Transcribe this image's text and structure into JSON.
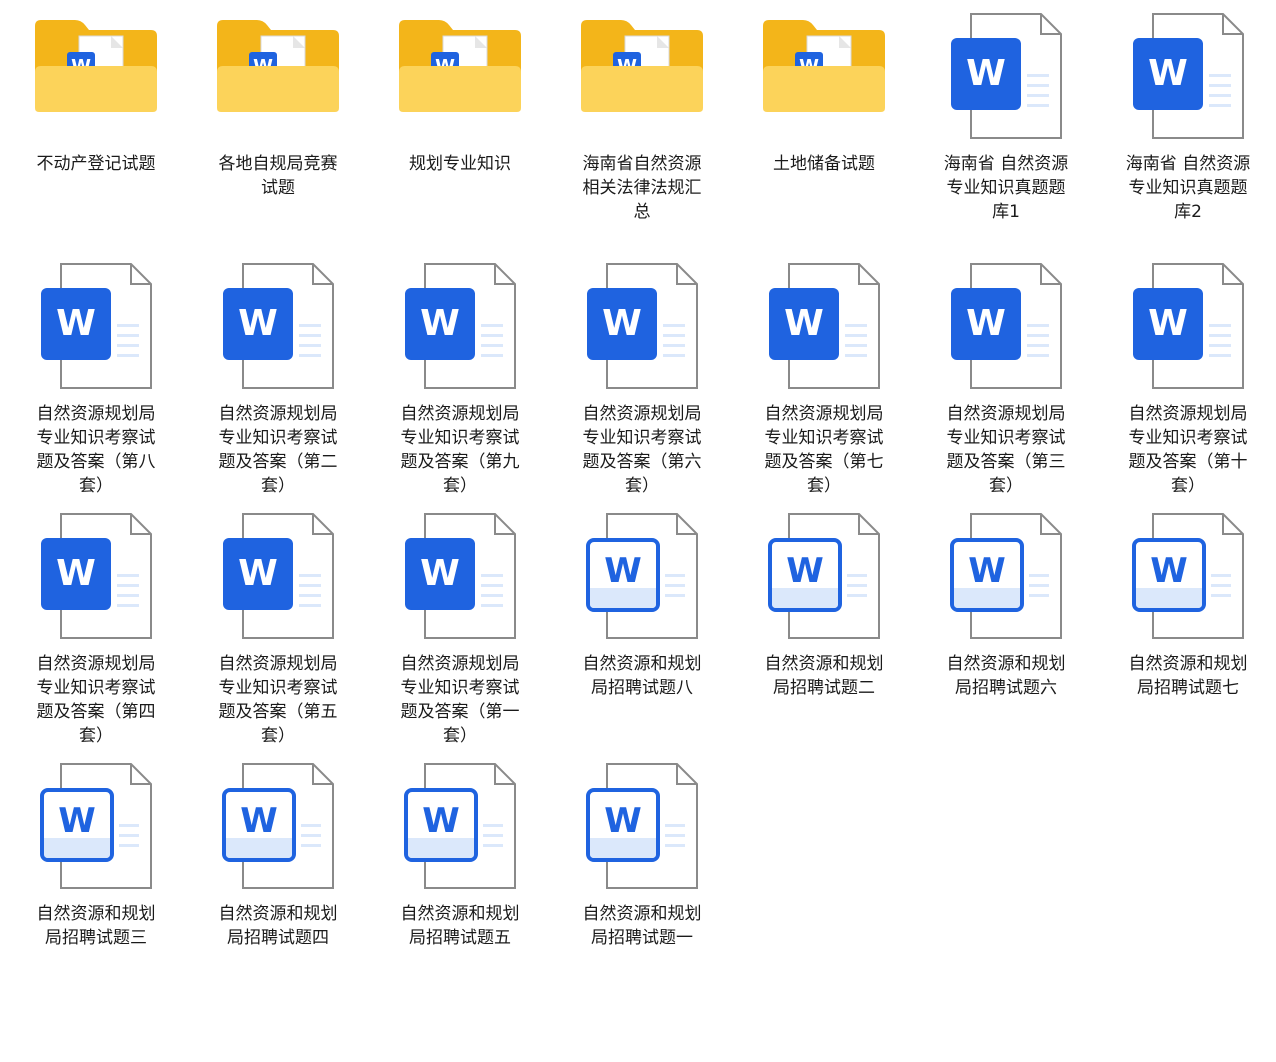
{
  "files": [
    {
      "type": "folder",
      "name": "不动产登记试题"
    },
    {
      "type": "folder",
      "name": "各地自规局竞赛试题"
    },
    {
      "type": "folder",
      "name": "规划专业知识"
    },
    {
      "type": "folder",
      "name": "海南省自然资源相关法律法规汇总"
    },
    {
      "type": "folder",
      "name": "土地储备试题"
    },
    {
      "type": "docx",
      "name": "海南省  自然资源专业知识真题题库1"
    },
    {
      "type": "docx",
      "name": "海南省 自然资源专业知识真题题库2"
    },
    {
      "type": "docx",
      "name": "自然资源规划局专业知识考察试题及答案（第八套）"
    },
    {
      "type": "docx",
      "name": "自然资源规划局专业知识考察试题及答案（第二套）"
    },
    {
      "type": "docx",
      "name": "自然资源规划局专业知识考察试题及答案（第九套）"
    },
    {
      "type": "docx",
      "name": "自然资源规划局专业知识考察试题及答案（第六套）"
    },
    {
      "type": "docx",
      "name": "自然资源规划局专业知识考察试题及答案（第七套）"
    },
    {
      "type": "docx",
      "name": "自然资源规划局专业知识考察试题及答案（第三套）"
    },
    {
      "type": "docx",
      "name": "自然资源规划局专业知识考察试题及答案（第十套）"
    },
    {
      "type": "docx",
      "name": "自然资源规划局专业知识考察试题及答案（第四套）"
    },
    {
      "type": "docx",
      "name": "自然资源规划局专业知识考察试题及答案（第五套）"
    },
    {
      "type": "docx",
      "name": "自然资源规划局专业知识考察试题及答案（第一套）"
    },
    {
      "type": "doc",
      "name": "自然资源和规划局招聘试题八"
    },
    {
      "type": "doc",
      "name": "自然资源和规划局招聘试题二"
    },
    {
      "type": "doc",
      "name": "自然资源和规划局招聘试题六"
    },
    {
      "type": "doc",
      "name": "自然资源和规划局招聘试题七"
    },
    {
      "type": "doc",
      "name": "自然资源和规划局招聘试题三"
    },
    {
      "type": "doc",
      "name": "自然资源和规划局招聘试题四"
    },
    {
      "type": "doc",
      "name": "自然资源和规划局招聘试题五"
    },
    {
      "type": "doc",
      "name": "自然资源和规划局招聘试题一"
    }
  ],
  "icons": {
    "folder": "folder-with-word-document-icon",
    "docx": "word-document-icon",
    "doc": "word-legacy-document-icon",
    "word_letter": "W"
  },
  "colors": {
    "folder_back": "#f3b51a",
    "folder_front": "#fcd35a",
    "word_blue": "#1f63e0",
    "word_blue_light": "#dbe8fb",
    "doc_outline": "#8a8a8a"
  }
}
